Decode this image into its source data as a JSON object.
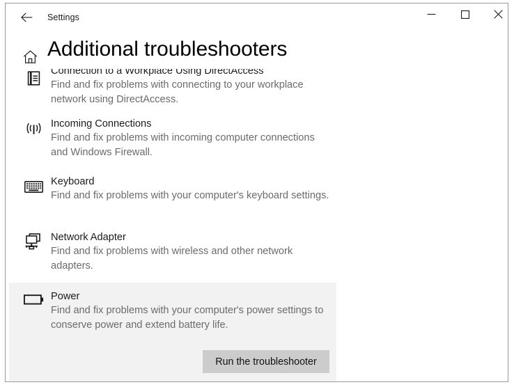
{
  "window": {
    "app_title": "Settings",
    "back_icon": "back-arrow-icon",
    "minimize_icon": "minimize-icon",
    "maximize_icon": "maximize-icon",
    "close_icon": "close-icon"
  },
  "page": {
    "home_icon": "home-icon",
    "title": "Additional troubleshooters"
  },
  "troubleshooters": [
    {
      "icon": "directaccess-workplace-icon",
      "title": "Connection to a Workplace Using DirectAccess",
      "desc": "Find and fix problems with connecting to your workplace network using DirectAccess.",
      "selected": false
    },
    {
      "icon": "broadcast-antenna-icon",
      "title": "Incoming Connections",
      "desc": "Find and fix problems with incoming computer connections and Windows Firewall.",
      "selected": false
    },
    {
      "icon": "keyboard-icon",
      "title": "Keyboard",
      "desc": "Find and fix problems with your computer's keyboard settings.",
      "selected": false
    },
    {
      "icon": "network-adapter-icon",
      "title": "Network Adapter",
      "desc": "Find and fix problems with wireless and other network adapters.",
      "selected": false
    },
    {
      "icon": "battery-power-icon",
      "title": "Power",
      "desc": "Find and fix problems with your computer's power settings to conserve power and extend battery life.",
      "selected": true
    }
  ],
  "actions": {
    "run_troubleshooter_label": "Run the troubleshooter"
  },
  "colors": {
    "selected_panel_bg": "#f2f2f2",
    "button_bg": "#cccccc",
    "title_text": "#1b1b1b",
    "desc_text": "#6b6b6b",
    "window_border": "#9a9a9a"
  }
}
